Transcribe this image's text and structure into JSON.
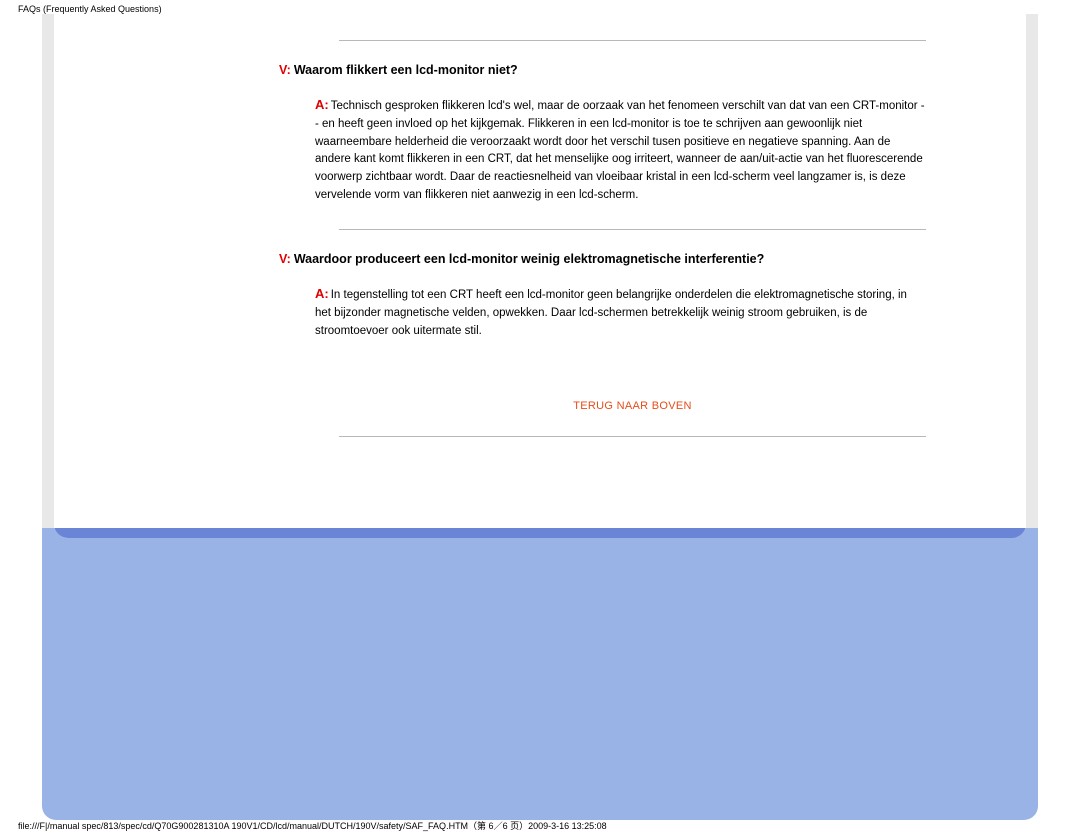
{
  "header": {
    "title": "FAQs (Frequently Asked Questions)"
  },
  "faq": [
    {
      "q_prefix": "V:",
      "question": "Waarom flikkert een lcd-monitor niet?",
      "a_prefix": "A:",
      "answer": "Technisch gesproken flikkeren lcd's wel, maar de oorzaak van het fenomeen verschilt van dat van een CRT-monitor -- en heeft geen invloed op het kijkgemak. Flikkeren in een lcd-monitor is toe te schrijven aan gewoonlijk niet waarneembare helderheid die veroorzaakt wordt door het verschil tusen positieve en negatieve spanning. Aan de andere kant komt flikkeren in een CRT, dat het menselijke oog irriteert, wanneer de aan/uit-actie van het fluorescerende voorwerp zichtbaar wordt. Daar de reactiesnelheid van vloeibaar kristal in een lcd-scherm veel langzamer is, is deze vervelende vorm van flikkeren niet aanwezig in een lcd-scherm."
    },
    {
      "q_prefix": "V:",
      "question": "Waardoor produceert een lcd-monitor weinig elektromagnetische interferentie?",
      "a_prefix": "A:",
      "answer": "In tegenstelling tot een CRT heeft een lcd-monitor geen belangrijke onderdelen die elektromagnetische storing, in het bijzonder magnetische velden, opwekken. Daar lcd-schermen betrekkelijk weinig stroom gebruiken, is de stroomtoevoer ook uitermate stil."
    }
  ],
  "back_to_top": "TERUG NAAR BOVEN",
  "footer": {
    "path": "file:///F|/manual spec/813/spec/cd/Q70G900281310A 190V1/CD/lcd/manual/DUTCH/190V/safety/SAF_FAQ.HTM（第 6／6 页）2009-3-16 13:25:08"
  }
}
